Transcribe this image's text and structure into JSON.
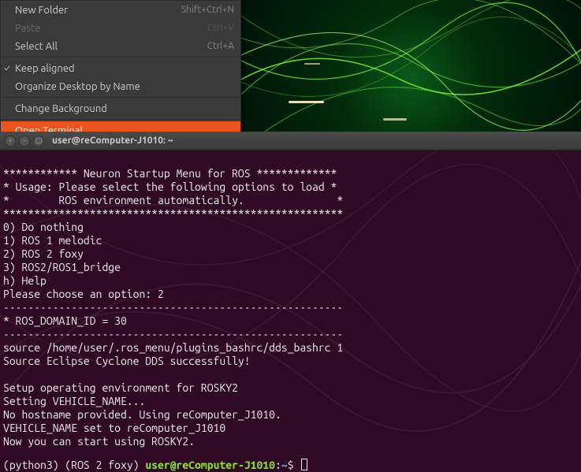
{
  "context_menu": {
    "items": [
      {
        "label": "New Folder",
        "shortcut": "Shift+Ctrl+N",
        "disabled": false
      },
      {
        "label": "Paste",
        "shortcut": "Ctrl+V",
        "disabled": true
      },
      {
        "label": "Select All",
        "shortcut": "Ctrl+A",
        "disabled": false
      },
      {
        "label": "Keep aligned",
        "shortcut": "",
        "checked": true
      },
      {
        "label": "Organize Desktop by Name",
        "shortcut": ""
      },
      {
        "label": "Change Background",
        "shortcut": ""
      },
      {
        "label": "Open Terminal",
        "shortcut": "",
        "selected": true
      }
    ]
  },
  "terminal": {
    "title": "user@reComputer-J1010: ~",
    "lines": [
      "************ Neuron Startup Menu for ROS *************",
      "* Usage: Please select the following options to load *",
      "*        ROS environment automatically.               *",
      "*******************************************************",
      "0) Do nothing",
      "1) ROS 1 melodic",
      "2) ROS 2 foxy",
      "3) ROS2/ROS1_bridge",
      "h) Help",
      "Please choose an option: 2",
      "-------------------------------------------------------",
      "* ROS_DOMAIN_ID = 30",
      "-------------------------------------------------------",
      "source /home/user/.ros_menu/plugins_bashrc/dds_bashrc 1",
      "Source Eclipse Cyclone DDS successfully!",
      "",
      "Setup operating environment for ROSKY2",
      "Setting VEHICLE_NAME...",
      "No hostname provided. Using reComputer_J1010.",
      "VEHICLE_NAME set to reComputer_J1010",
      "Now you can start using ROSKY2."
    ],
    "prompt": {
      "env": "(python3) (ROS 2 foxy) ",
      "user": "user",
      "host": "reComputer-J1010",
      "path": "~",
      "symbol": "$"
    }
  }
}
